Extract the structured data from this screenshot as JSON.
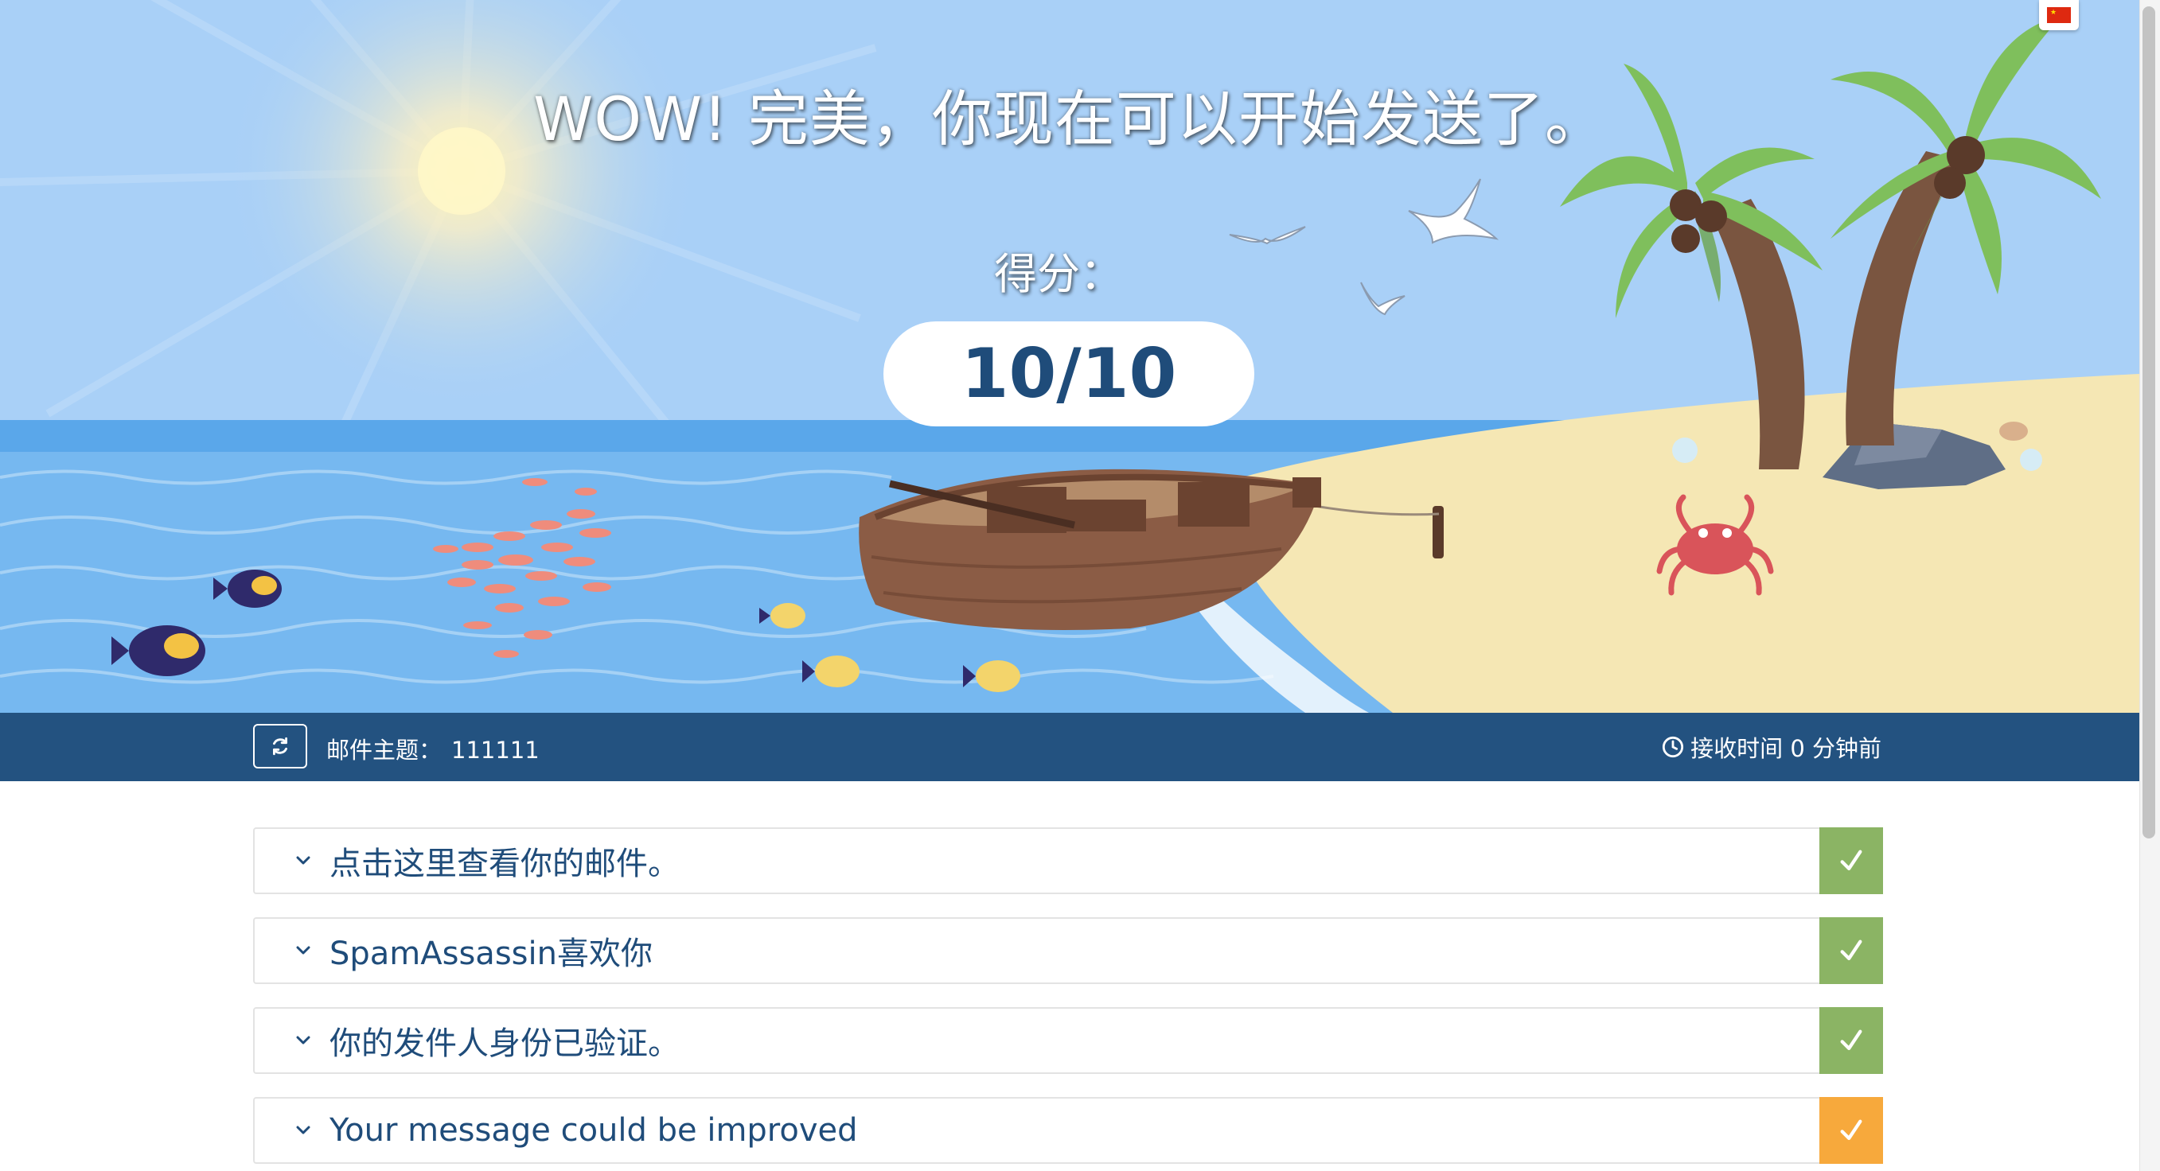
{
  "hero": {
    "headline": "WOW! 完美，你现在可以开始发送了。",
    "score_label": "得分：",
    "score": "10/10",
    "language_icon": "china-flag-icon"
  },
  "meta": {
    "subject_label": "邮件主题：",
    "subject_value": "111111",
    "received": "接收时间 0 分钟前",
    "refresh_icon": "refresh-icon",
    "clock_icon": "clock-icon"
  },
  "results": [
    {
      "label": "点击这里查看你的邮件。",
      "status": "pass",
      "icon": "check-icon"
    },
    {
      "label": "SpamAssassin喜欢你",
      "status": "pass",
      "icon": "check-icon"
    },
    {
      "label": "你的发件人身份已验证。",
      "status": "pass",
      "icon": "check-icon"
    },
    {
      "label": "Your message could be improved",
      "status": "warn",
      "icon": "check-icon"
    }
  ],
  "colors": {
    "primary": "#235280",
    "text": "#1f4c7a",
    "pass": "#8bb464",
    "warn": "#f7a93c",
    "sky": "#a9d0f7",
    "sea": "#76b8f0",
    "sand": "#f5e7b4"
  }
}
